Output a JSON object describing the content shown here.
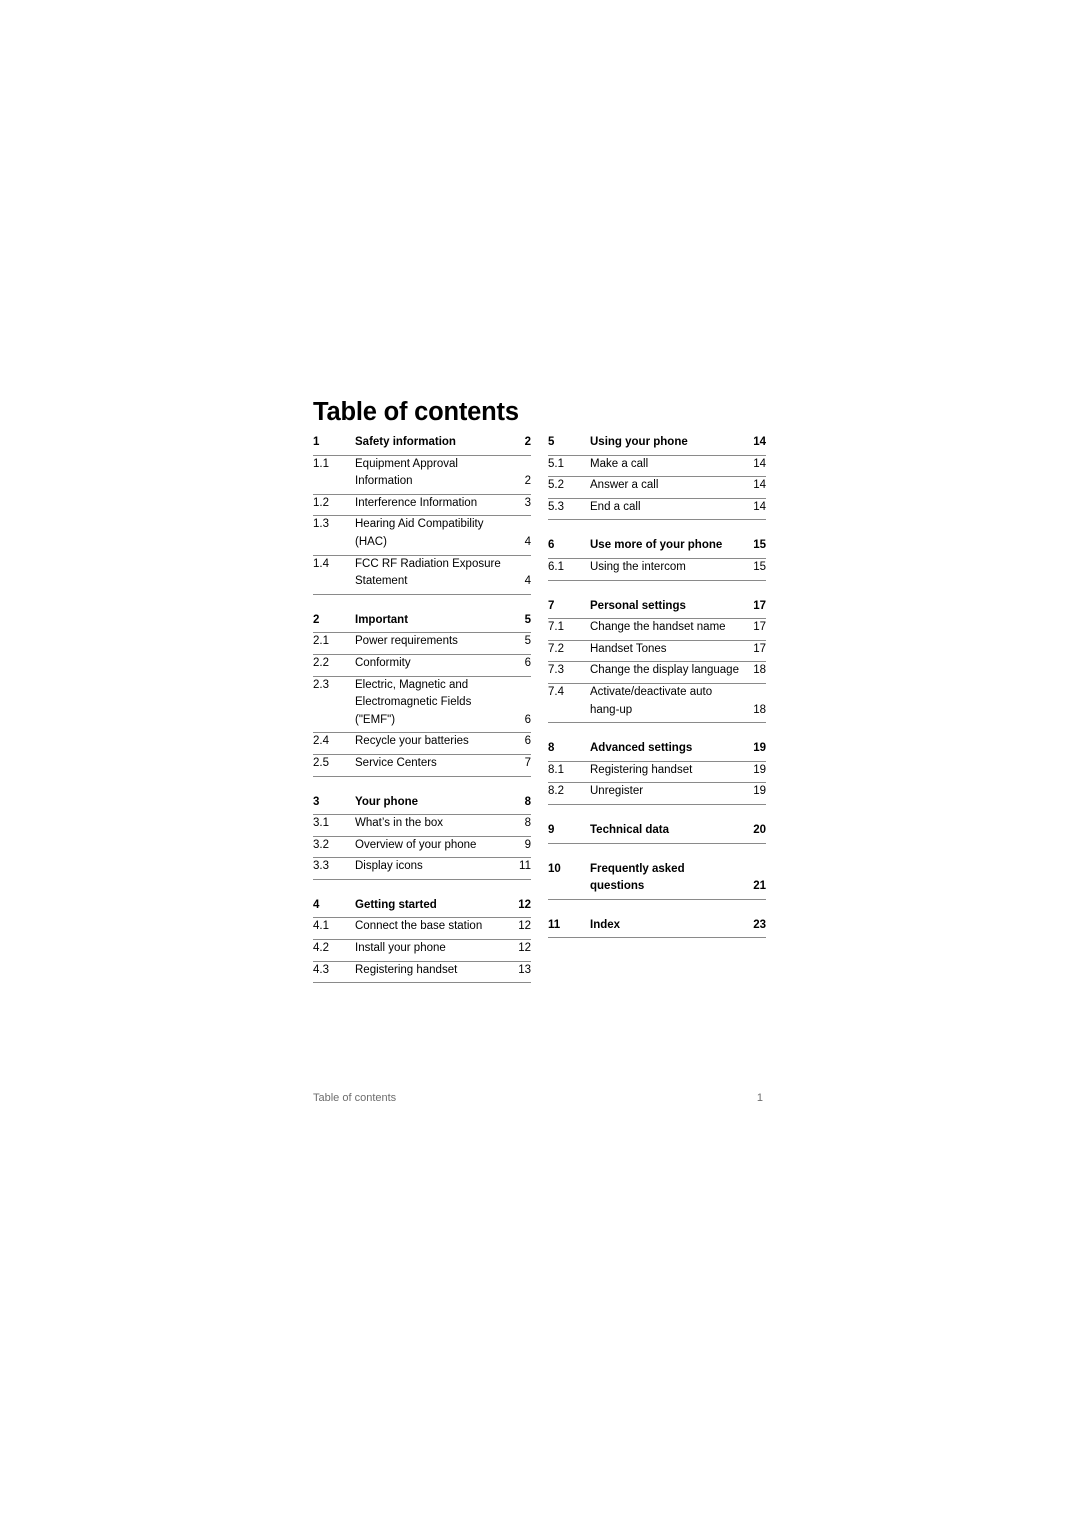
{
  "document": {
    "title": "Table of contents"
  },
  "footer": {
    "left_text": "Table of contents",
    "page_number": "1"
  },
  "columns": [
    {
      "name": "left-column",
      "entries": [
        {
          "type": "section",
          "number": "1",
          "lines": [
            "Safety information"
          ],
          "page": "2"
        },
        {
          "type": "sub",
          "number": "1.1",
          "lines": [
            "Equipment Approval",
            "Information"
          ],
          "page": "2"
        },
        {
          "type": "sub",
          "number": "1.2",
          "lines": [
            "Interference Information"
          ],
          "page": "3"
        },
        {
          "type": "sub",
          "number": "1.3",
          "lines": [
            "Hearing Aid Compatibility",
            "(HAC)"
          ],
          "page": "4"
        },
        {
          "type": "sub",
          "number": "1.4",
          "lines": [
            "FCC RF Radiation Exposure",
            "Statement"
          ],
          "page": "4"
        },
        {
          "type": "section",
          "number": "2",
          "lines": [
            "Important"
          ],
          "page": "5"
        },
        {
          "type": "sub",
          "number": "2.1",
          "lines": [
            "Power requirements"
          ],
          "page": "5"
        },
        {
          "type": "sub",
          "number": "2.2",
          "lines": [
            "Conformity"
          ],
          "page": "6"
        },
        {
          "type": "sub",
          "number": "2.3",
          "lines": [
            "Electric, Magnetic and",
            "Electromagnetic Fields (\"EMF\")"
          ],
          "page": "6"
        },
        {
          "type": "sub",
          "number": "2.4",
          "lines": [
            "Recycle your batteries"
          ],
          "page": "6"
        },
        {
          "type": "sub",
          "number": "2.5",
          "lines": [
            "Service Centers"
          ],
          "page": "7"
        },
        {
          "type": "section",
          "number": "3",
          "lines": [
            "Your phone"
          ],
          "page": "8"
        },
        {
          "type": "sub",
          "number": "3.1",
          "lines": [
            "What’s in the box"
          ],
          "page": "8"
        },
        {
          "type": "sub",
          "number": "3.2",
          "lines": [
            "Overview of your phone"
          ],
          "page": "9"
        },
        {
          "type": "sub",
          "number": "3.3",
          "lines": [
            "Display icons"
          ],
          "page": "11"
        },
        {
          "type": "section",
          "number": "4",
          "lines": [
            "Getting started"
          ],
          "page": "12"
        },
        {
          "type": "sub",
          "number": "4.1",
          "lines": [
            "Connect the base station"
          ],
          "page": "12"
        },
        {
          "type": "sub",
          "number": "4.2",
          "lines": [
            "Install your phone"
          ],
          "page": "12"
        },
        {
          "type": "sub",
          "number": "4.3",
          "lines": [
            "Registering handset"
          ],
          "page": "13"
        }
      ]
    },
    {
      "name": "right-column",
      "entries": [
        {
          "type": "section",
          "number": "5",
          "lines": [
            "Using your phone"
          ],
          "page": "14"
        },
        {
          "type": "sub",
          "number": "5.1",
          "lines": [
            "Make a call"
          ],
          "page": "14"
        },
        {
          "type": "sub",
          "number": "5.2",
          "lines": [
            "Answer a call"
          ],
          "page": "14"
        },
        {
          "type": "sub",
          "number": "5.3",
          "lines": [
            "End a call"
          ],
          "page": "14"
        },
        {
          "type": "section",
          "number": "6",
          "lines": [
            "Use more of your phone"
          ],
          "page": "15"
        },
        {
          "type": "sub",
          "number": "6.1",
          "lines": [
            "Using the intercom"
          ],
          "page": "15"
        },
        {
          "type": "section",
          "number": "7",
          "lines": [
            "Personal settings"
          ],
          "page": "17"
        },
        {
          "type": "sub",
          "number": "7.1",
          "lines": [
            "Change the handset name"
          ],
          "page": "17"
        },
        {
          "type": "sub",
          "number": "7.2",
          "lines": [
            "Handset Tones"
          ],
          "page": "17"
        },
        {
          "type": "sub",
          "number": "7.3",
          "lines": [
            "Change the display language"
          ],
          "page": "18"
        },
        {
          "type": "sub",
          "number": "7.4",
          "lines": [
            "Activate/deactivate auto",
            "hang-up"
          ],
          "page": "18"
        },
        {
          "type": "section",
          "number": "8",
          "lines": [
            "Advanced settings"
          ],
          "page": "19"
        },
        {
          "type": "sub",
          "number": "8.1",
          "lines": [
            "Registering handset"
          ],
          "page": "19"
        },
        {
          "type": "sub",
          "number": "8.2",
          "lines": [
            "Unregister"
          ],
          "page": "19"
        },
        {
          "type": "section",
          "number": "9",
          "lines": [
            "Technical data"
          ],
          "page": "20"
        },
        {
          "type": "section",
          "number": "10",
          "lines": [
            "Frequently asked",
            "questions"
          ],
          "page": "21"
        },
        {
          "type": "section",
          "number": "11",
          "lines": [
            "Index"
          ],
          "page": "23"
        }
      ]
    }
  ]
}
